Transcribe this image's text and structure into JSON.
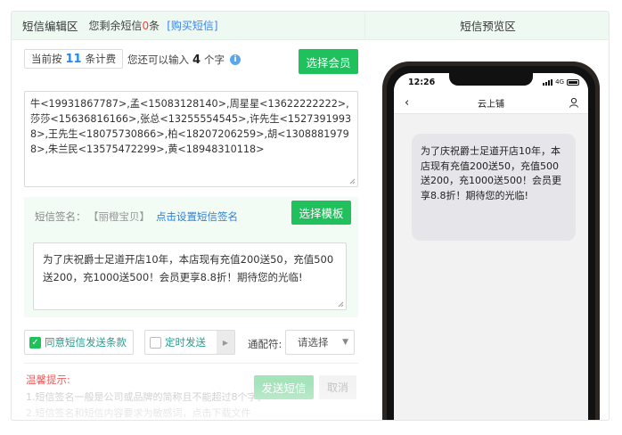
{
  "header": {
    "editor_title": "短信编辑区",
    "remaining_prefix": "您剩余短信",
    "remaining_count": "0",
    "remaining_suffix": "条",
    "buy_link": "[购买短信]",
    "preview_title": "短信预览区"
  },
  "billing": {
    "prefix": "当前按",
    "count": "11",
    "suffix": "条计费"
  },
  "input_remaining": {
    "prefix": "您还可以输入",
    "count": "4",
    "suffix": "个字"
  },
  "buttons": {
    "select_member": "选择会员",
    "select_template": "选择模板",
    "send": "发送短信",
    "cancel": "取消"
  },
  "recipients_text": "牛<19931867787>,孟<15083128140>,周星星<13622222222>,莎莎<15636816166>,张总<13255554545>,许先生<15273919938>,王先生<18075730866>,柏<18207206259>,胡<13088819798>,朱兰民<13575472299>,黄<18948310118>",
  "signature": {
    "label": "短信签名：",
    "name": "【丽橙宝贝】",
    "set_link": "点击设置短信签名"
  },
  "message_text": "为了庆祝爵士足道开店10年，本店现有充值200送50，充值500送200，充1000送500！会员更享8.8折！期待您的光临!",
  "options": {
    "agree_label": "同意短信发送条款",
    "agree_checked": true,
    "timer_label": "定时发送",
    "timer_checked": false,
    "wildcard_label": "通配符:",
    "wildcard_value": "请选择"
  },
  "tips": {
    "title": "温馨提示:",
    "line1": "1.短信签名一般是公司或品牌的简称且不能超过8个字。",
    "line2": "2.短信签名和短信内容要求为敏感词，点击下载文件"
  },
  "phone": {
    "time": "12:26",
    "network": "4G",
    "contact_name": "云上铺",
    "bubble_text": "为了庆祝爵士足道开店10年，本店现有充值200送50，充值500送200，充1000送500！会员更享8.8折！期待您的光临!"
  },
  "colors": {
    "accent_green": "#20c05c",
    "header_bg": "#eef9f1",
    "link_blue": "#2f80d8",
    "tip_red": "#f15b5b"
  }
}
